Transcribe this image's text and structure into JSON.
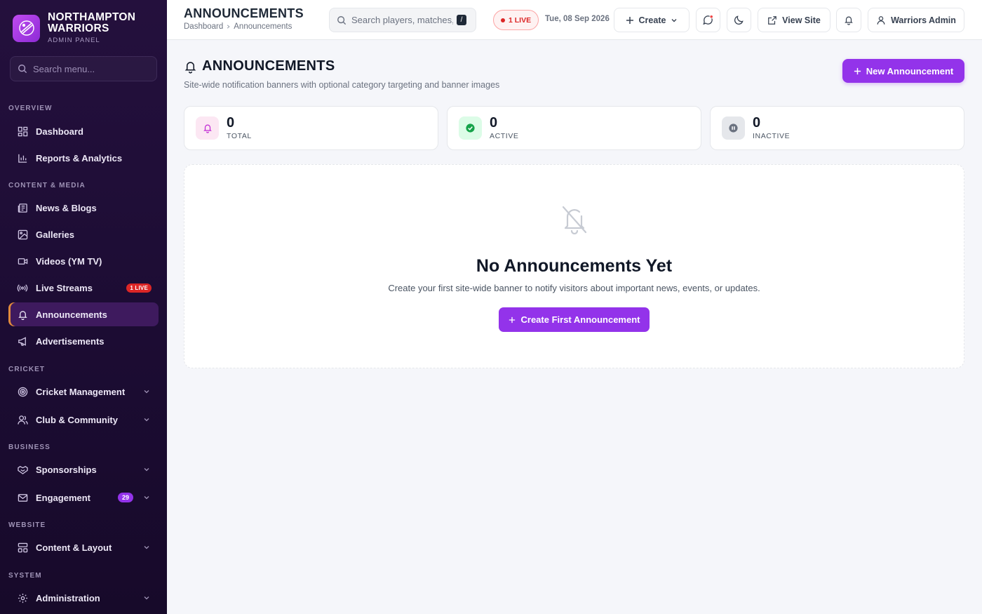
{
  "brand": {
    "title_line1": "NORTHAMPTON",
    "title_line2": "WARRIORS",
    "subtitle": "ADMIN PANEL"
  },
  "sidebar": {
    "search_placeholder": "Search menu...",
    "sections": {
      "overview": "OVERVIEW",
      "content": "CONTENT & MEDIA",
      "cricket": "CRICKET",
      "business": "BUSINESS",
      "website": "WEBSITE",
      "system": "SYSTEM"
    },
    "items": {
      "dashboard": "Dashboard",
      "reports": "Reports & Analytics",
      "news": "News & Blogs",
      "galleries": "Galleries",
      "videos": "Videos (YM TV)",
      "live_streams": "Live Streams",
      "live_streams_badge": "1 LIVE",
      "announcements": "Announcements",
      "advertisements": "Advertisements",
      "cricket_management": "Cricket Management",
      "club_community": "Club & Community",
      "sponsorships": "Sponsorships",
      "engagement": "Engagement",
      "engagement_badge": "29",
      "content_layout": "Content & Layout",
      "administration": "Administration"
    },
    "active": "announcements"
  },
  "topbar": {
    "title": "ANNOUNCEMENTS",
    "breadcrumb": [
      "Dashboard",
      "Announcements"
    ],
    "search_placeholder": "Search players, matches, n",
    "search_shortcut": "/",
    "live_label": "1 LIVE",
    "date": "Tue, 08 Sep 2026",
    "create_label": "Create",
    "view_site_label": "View Site",
    "user_label": "Warriors Admin"
  },
  "page": {
    "title": "ANNOUNCEMENTS",
    "subtitle": "Site-wide notification banners with optional category targeting and banner images",
    "new_button": "New Announcement"
  },
  "stats": [
    {
      "value": "0",
      "label": "TOTAL"
    },
    {
      "value": "0",
      "label": "ACTIVE"
    },
    {
      "value": "0",
      "label": "INACTIVE"
    }
  ],
  "empty_state": {
    "title": "No Announcements Yet",
    "text": "Create your first site-wide banner to notify visitors about important news, events, or updates.",
    "button": "Create First Announcement"
  },
  "colors": {
    "accent": "#9333ea",
    "sidebar_bg": "#1e0d35",
    "live_red": "#dc2626"
  }
}
